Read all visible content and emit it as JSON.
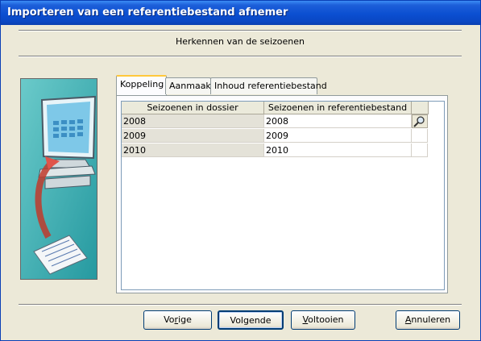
{
  "window": {
    "title": "Importeren van een referentiebestand afnemer"
  },
  "header": {
    "subtitle": "Herkennen van de seizoenen"
  },
  "tabs": [
    {
      "label": "Koppeling",
      "active": true
    },
    {
      "label": "Aanmaak",
      "active": false
    },
    {
      "label": "Inhoud referentiebestand",
      "active": false
    }
  ],
  "grid": {
    "columns": [
      "Seizoenen in dossier",
      "Seizoenen in referentiebestand"
    ],
    "rows": [
      {
        "dossier": "2008",
        "referentie": "2008"
      },
      {
        "dossier": "2009",
        "referentie": "2009"
      },
      {
        "dossier": "2010",
        "referentie": "2010"
      }
    ],
    "lookup_icon": "magnifier-icon"
  },
  "buttons": {
    "vorige": {
      "pre": "Vo",
      "mnemonic": "r",
      "post": "ige"
    },
    "volgende": {
      "pre": "",
      "mnemonic": "",
      "post": "Volgende"
    },
    "voltooien": {
      "pre": "",
      "mnemonic": "V",
      "post": "oltooien"
    },
    "annuleren": {
      "pre": "",
      "mnemonic": "A",
      "post": "nnuleren"
    }
  },
  "colors": {
    "titlebar": "#0a47c4",
    "window_bg": "#ece9d8",
    "tab_highlight": "#ffc83c",
    "illustration_bg": "#2fa8a8"
  }
}
